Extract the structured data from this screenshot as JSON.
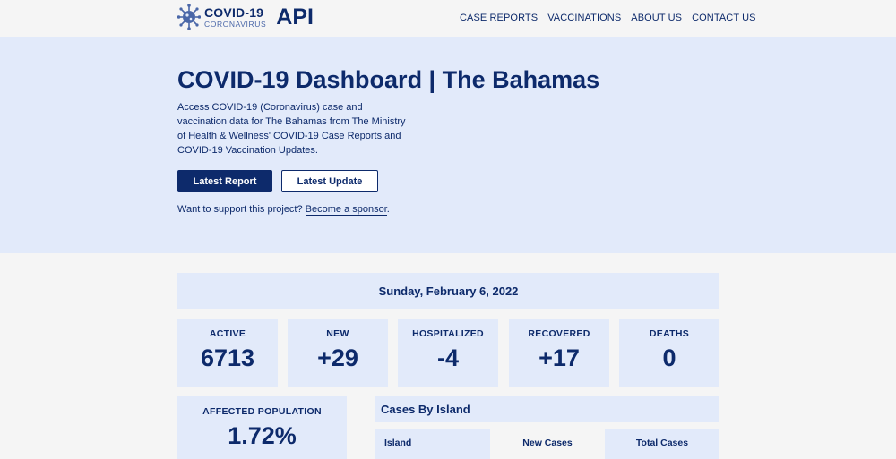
{
  "brand": {
    "title": "COVID-19",
    "subtitle": "CORONAVIRUS",
    "api": "API"
  },
  "nav": {
    "items": [
      "CASE REPORTS",
      "VACCINATIONS",
      "ABOUT US",
      "CONTACT US"
    ]
  },
  "hero": {
    "title": "COVID-19 Dashboard | The Bahamas",
    "description": "Access COVID-19 (Coronavirus) case and vaccination data for The Bahamas from The Ministry of Health & Wellness' COVID-19 Case Reports and COVID-19 Vaccination Updates.",
    "primary_button": "Latest Report",
    "secondary_button": "Latest Update",
    "support_text": "Want to support this project?",
    "support_link": "Become a sponsor",
    "support_end": "."
  },
  "report": {
    "date": "Sunday, February 6, 2022",
    "stats": [
      {
        "label": "ACTIVE",
        "value": "6713"
      },
      {
        "label": "NEW",
        "value": "+29"
      },
      {
        "label": "HOSPITALIZED",
        "value": "-4"
      },
      {
        "label": "RECOVERED",
        "value": "+17"
      },
      {
        "label": "DEATHS",
        "value": "0"
      }
    ],
    "affected": {
      "label": "AFFECTED POPULATION",
      "value": "1.72%"
    },
    "islands": {
      "title": "Cases By Island",
      "columns": [
        "Island",
        "New Cases",
        "Total Cases"
      ]
    }
  },
  "colors": {
    "primary": "#0d2a6b",
    "panel": "#e2eafa",
    "background": "#f5f5f5"
  }
}
